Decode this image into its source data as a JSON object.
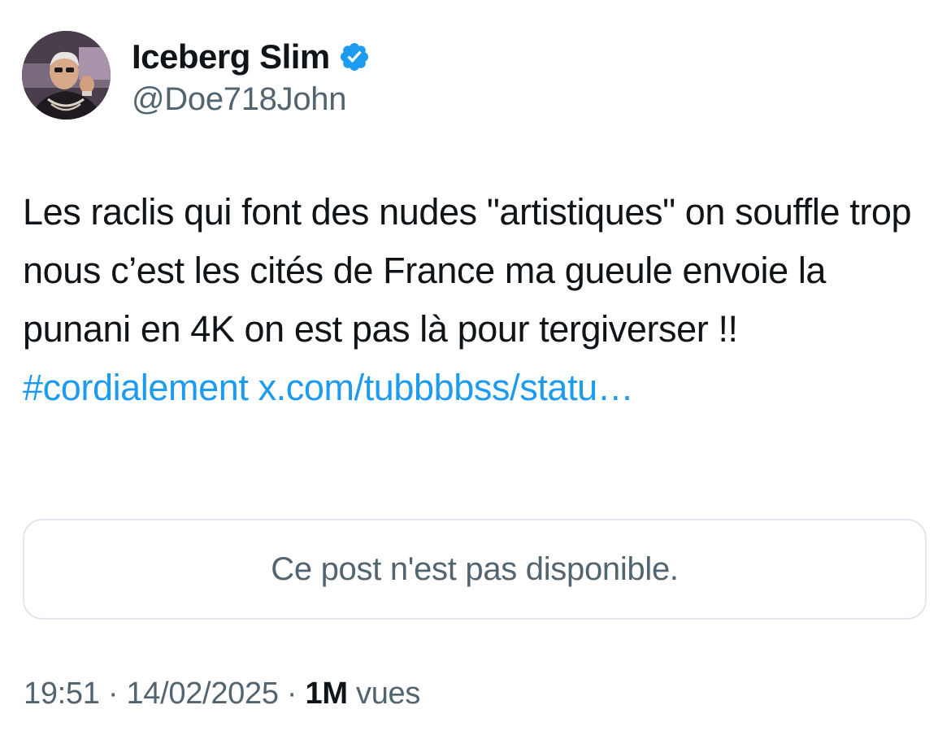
{
  "author": {
    "display_name": "Iceberg Slim",
    "handle": "@Doe718John",
    "verified": true,
    "verified_color": "#1d9bf0",
    "avatar_icon": "profile-photo-avatar"
  },
  "post": {
    "text_plain": "Les raclis qui font des nudes \"artistiques\" on souffle trop nous c’est les cités de France ma gueule envoie la punani en 4K on est pas là pour tergiverser !!",
    "hashtag": "#cordialement",
    "link": "x.com/tubbbbss/statu…",
    "link_color": "#1d9bf0"
  },
  "quoted_post": {
    "unavailable_text": "Ce post n'est pas disponible."
  },
  "meta": {
    "time": "19:51",
    "separator_1": " · ",
    "date": "14/02/2025",
    "separator_2": " · ",
    "views_count": "1M",
    "views_label": " vues"
  }
}
